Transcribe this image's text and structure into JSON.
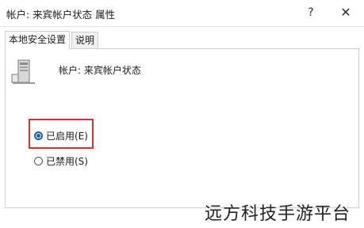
{
  "window": {
    "title": "帐户: 来宾帐户状态 属性",
    "help_glyph": "?",
    "close_glyph": "✕"
  },
  "tabs": [
    {
      "label": "本地安全设置",
      "active": true
    },
    {
      "label": "说明",
      "active": false
    }
  ],
  "policy": {
    "icon": "server-icon",
    "name": "帐户: 来宾帐户状态"
  },
  "options": [
    {
      "label": "已启用(E)",
      "checked": true
    },
    {
      "label": "已禁用(S)",
      "checked": false
    }
  ],
  "watermark": "远方科技手游平台",
  "colors": {
    "highlight_border": "#d9342b",
    "radio_accent": "#1a5fb4"
  }
}
